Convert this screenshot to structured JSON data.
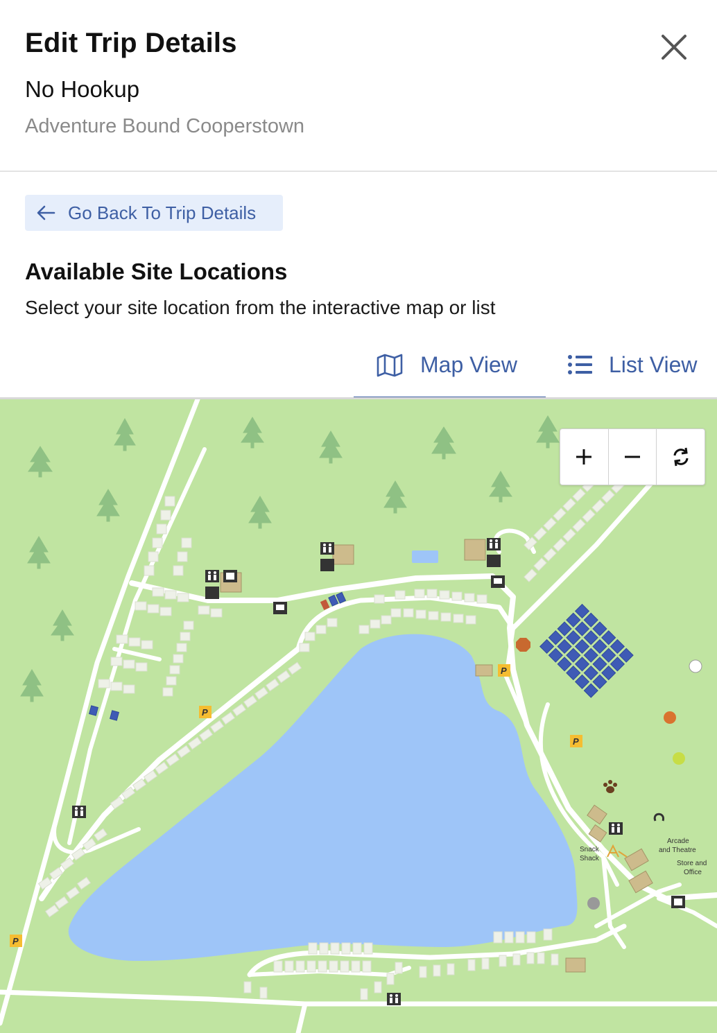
{
  "header": {
    "title": "Edit Trip Details",
    "site_type": "No Hookup",
    "campground": "Adventure Bound Cooperstown"
  },
  "back_button": {
    "label": "Go Back To Trip Details"
  },
  "section": {
    "title": "Available Site Locations",
    "description": "Select your site location from the interactive map or list"
  },
  "tabs": [
    {
      "label": "Map View",
      "active": true
    },
    {
      "label": "List View",
      "active": false
    }
  ],
  "map": {
    "labels": {
      "snack": "Snack\nShack",
      "arcade": "Arcade\nand Theatre",
      "store": "Store and\nOffice"
    },
    "zoom_controls": [
      "zoom-in",
      "zoom-out",
      "reset"
    ]
  },
  "colors": {
    "accent": "#3e5fa4",
    "grass": "#c0e4a1",
    "lake": "#9ec5f8",
    "site_available": "#3f5bb5"
  }
}
